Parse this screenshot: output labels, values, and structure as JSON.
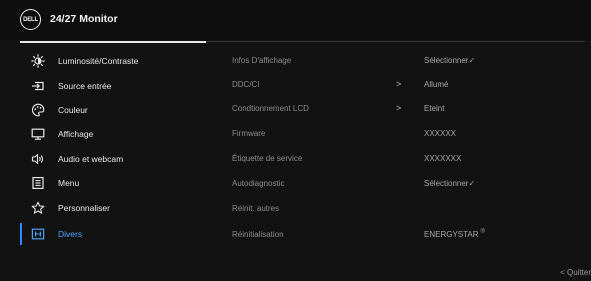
{
  "header": {
    "logo_text": "DELL",
    "title": "24/27 Monitor"
  },
  "menu": [
    {
      "label": "Luminosité/Contraste",
      "icon": "brightness-icon",
      "active": false
    },
    {
      "label": "Source entrée",
      "icon": "input-source-icon",
      "active": false
    },
    {
      "label": "Couleur",
      "icon": "color-palette-icon",
      "active": false
    },
    {
      "label": "Affichage",
      "icon": "display-icon",
      "active": false
    },
    {
      "label": "Audio et webcam",
      "icon": "speaker-icon",
      "active": false
    },
    {
      "label": "Menu",
      "icon": "menu-list-icon",
      "active": false
    },
    {
      "label": "Personnaliser",
      "icon": "star-icon",
      "active": false
    },
    {
      "label": "Divers",
      "icon": "others-icon",
      "active": true
    }
  ],
  "submenu": [
    {
      "label": "Infos D'affichage",
      "value": "Sélectionner",
      "value_check": "✓"
    },
    {
      "label": "DDC/CI",
      "arrow": ">",
      "value": "Allumé"
    },
    {
      "label": "Condtionnement LCD",
      "arrow": ">",
      "value": "Eteint"
    },
    {
      "label": "Firmware",
      "value": "XXXXXX"
    },
    {
      "label": "Étiquette de service",
      "value": "XXXXXXX"
    },
    {
      "label": "Autodiagnostic",
      "value": "Sélectionner",
      "value_check": "✓"
    },
    {
      "label": "Réinit. autres"
    },
    {
      "label": "Réinitialisation",
      "value": "ENERGYSTAR",
      "value_reg": "®"
    }
  ],
  "footer": {
    "exit_label": "< Quitter"
  },
  "colors": {
    "accent": "#2f8cff",
    "background": "#121212",
    "text": "#e8e8e8",
    "muted": "#8c8c8c"
  }
}
